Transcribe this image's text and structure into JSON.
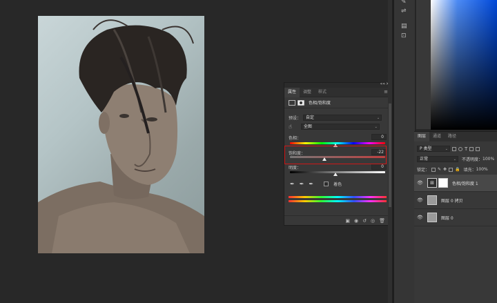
{
  "properties_panel": {
    "tabs": [
      "属性",
      "调整",
      "样式"
    ],
    "adjustment_title": "色相/饱和度",
    "preset_label": "预设：",
    "preset_value": "自定",
    "channel_value": "全图",
    "hue_label": "色相：",
    "hue_value": "0",
    "saturation_label": "饱和度：",
    "saturation_value": "-22",
    "lightness_label": "明度：",
    "lightness_value": "0",
    "colorize_label": "着色",
    "saturation_thumb_fraction": 0.39
  },
  "layers_panel": {
    "tabs": [
      "图层",
      "通道",
      "路径"
    ],
    "filter_value": "P 类型",
    "blend_mode": "正常",
    "opacity_label": "不透明度：",
    "opacity_value": "100%",
    "lock_label": "锁定：",
    "fill_label": "填充：",
    "fill_value": "100%",
    "layers": [
      {
        "name": "色相/饱和度 1",
        "type": "adjustment",
        "selected": true
      },
      {
        "name": "图层 0 拷贝",
        "type": "image",
        "selected": false
      },
      {
        "name": "图层 0",
        "type": "image",
        "selected": false
      }
    ]
  },
  "colors": {
    "highlight_box": "#d01818",
    "panel_bg": "#383838",
    "workspace_bg": "#282828"
  }
}
